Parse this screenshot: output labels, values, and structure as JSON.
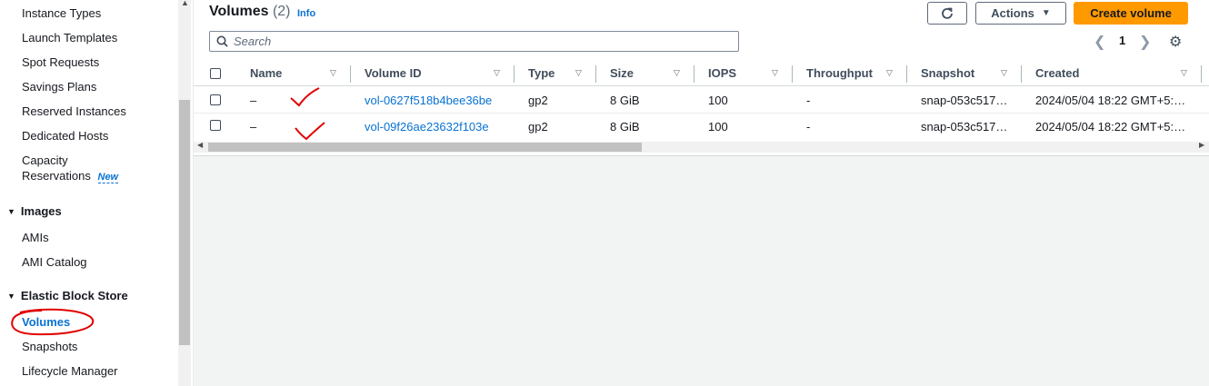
{
  "sidebar": {
    "items": [
      {
        "label": "Instance Types"
      },
      {
        "label": "Launch Templates"
      },
      {
        "label": "Spot Requests"
      },
      {
        "label": "Savings Plans"
      },
      {
        "label": "Reserved Instances"
      },
      {
        "label": "Dedicated Hosts"
      },
      {
        "label": "Capacity"
      },
      {
        "label": "Reservations"
      }
    ],
    "new_badge": "New",
    "images_section": "Images",
    "images_items": [
      {
        "label": "AMIs"
      },
      {
        "label": "AMI Catalog"
      }
    ],
    "ebs_section": "Elastic Block Store",
    "ebs_items": [
      {
        "label": "Volumes"
      },
      {
        "label": "Snapshots"
      },
      {
        "label": "Lifecycle Manager"
      }
    ]
  },
  "header": {
    "title": "Volumes",
    "count": "(2)",
    "info": "Info",
    "actions_label": "Actions",
    "create_label": "Create volume"
  },
  "search": {
    "placeholder": "Search"
  },
  "pagination": {
    "page": "1"
  },
  "table": {
    "columns": [
      "Name",
      "Volume ID",
      "Type",
      "Size",
      "IOPS",
      "Throughput",
      "Snapshot",
      "Created"
    ],
    "rows": [
      {
        "name": "–",
        "volume_id": "vol-0627f518b4bee36be",
        "type": "gp2",
        "size": "8 GiB",
        "iops": "100",
        "throughput": "-",
        "snapshot": "snap-053c517…",
        "created": "2024/05/04 18:22 GMT+5:…"
      },
      {
        "name": "–",
        "volume_id": "vol-09f26ae23632f103e",
        "type": "gp2",
        "size": "8 GiB",
        "iops": "100",
        "throughput": "-",
        "snapshot": "snap-053c517…",
        "created": "2024/05/04 18:22 GMT+5:…"
      }
    ]
  },
  "colors": {
    "accent": "#0972d3",
    "primary_button": "#ff9900",
    "annotation": "#e00000"
  }
}
